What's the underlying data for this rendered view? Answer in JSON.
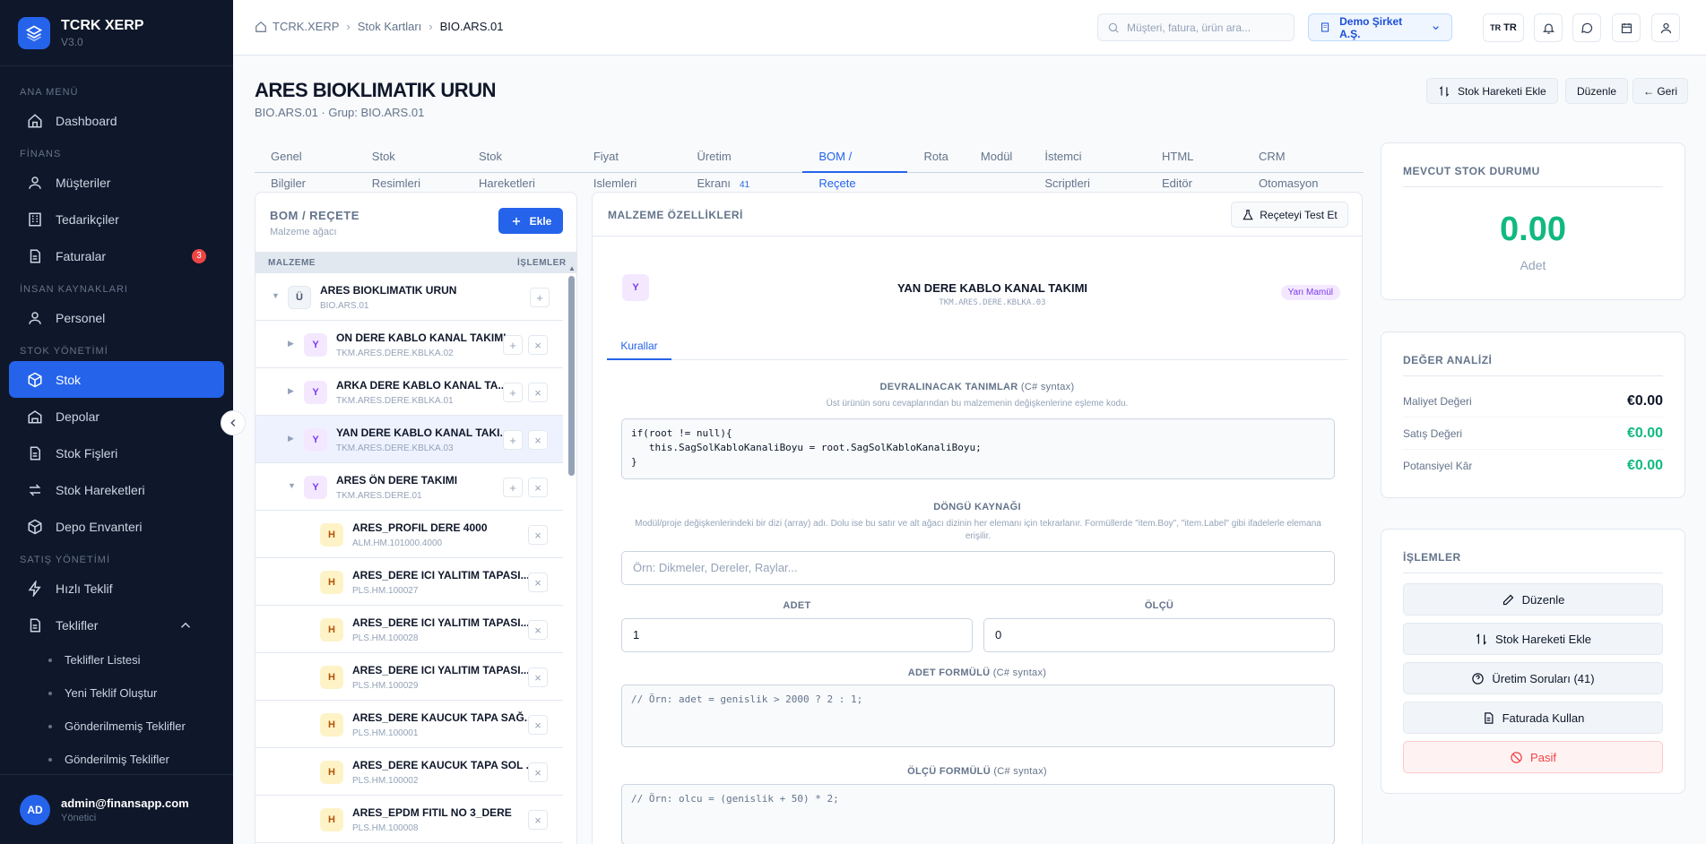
{
  "app": {
    "name": "TCRK XERP",
    "version": "V3.0"
  },
  "sidebar": {
    "sections": [
      "ANA MENÜ",
      "FİNANS",
      "İNSAN KAYNAKLARI",
      "STOK YÖNETİMİ",
      "SATIŞ YÖNETİMİ"
    ],
    "items": {
      "dashboard": "Dashboard",
      "musteriler": "Müşteriler",
      "tedarikciler": "Tedarikçiler",
      "faturalar": "Faturalar",
      "faturalar_badge": "3",
      "personel": "Personel",
      "stok": "Stok",
      "depolar": "Depolar",
      "stok_fisleri": "Stok Fişleri",
      "stok_hareketleri": "Stok Hareketleri",
      "depo_envanteri": "Depo Envanteri",
      "hizli_teklif": "Hızlı Teklif",
      "teklifler": "Teklifler"
    },
    "subitems": [
      "Teklifler Listesi",
      "Yeni Teklif Oluştur",
      "Gönderilmemiş Teklifler",
      "Gönderilmiş Teklifler"
    ]
  },
  "user": {
    "initials": "AD",
    "email": "admin@finansapp.com",
    "role": "Yönetici"
  },
  "topbar": {
    "breadcrumb": [
      "TCRK.XERP",
      "Stok Kartları",
      "BIO.ARS.01"
    ],
    "search_placeholder": "Müşteri, fatura, ürün ara...",
    "company": "Demo Şirket A.Ş.",
    "lang": "TR"
  },
  "page": {
    "title": "ARES BIOKLIMATIK URUN",
    "subtitle": "BIO.ARS.01 · Grup: BIO.ARS.01",
    "actions": {
      "add_movement": "Stok Hareketi Ekle",
      "edit": "Düzenle",
      "back": "← Geri"
    }
  },
  "tabs": [
    "Genel Bilgiler",
    "Stok Resimleri",
    "Stok Hareketleri",
    "Fiyat Islemleri",
    "Üretim Ekranı",
    "BOM / Reçete",
    "Rota",
    "Modül",
    "İstemci Scriptleri",
    "HTML Editör",
    "CRM Otomasyon"
  ],
  "tab_count": "41",
  "bom": {
    "title": "BOM / REÇETE",
    "subtitle": "Malzeme ağacı",
    "add": "Ekle",
    "col_material": "MALZEME",
    "col_actions": "İŞLEMLER",
    "rows": [
      {
        "type": "Ü",
        "name": "ARES BIOKLIMATIK URUN",
        "code": "BIO.ARS.01"
      },
      {
        "type": "Y",
        "name": "ON DERE KABLO KANAL TAKIMI",
        "code": "TKM.ARES.DERE.KBLKA.02"
      },
      {
        "type": "Y",
        "name": "ARKA DERE KABLO KANAL TA...",
        "code": "TKM.ARES.DERE.KBLKA.01"
      },
      {
        "type": "Y",
        "name": "YAN DERE KABLO KANAL TAKI...",
        "code": "TKM.ARES.DERE.KBLKA.03"
      },
      {
        "type": "Y",
        "name": "ARES ÖN DERE TAKIMI",
        "code": "TKM.ARES.DERE.01"
      },
      {
        "type": "H",
        "name": "ARES_PROFIL DERE 4000",
        "code": "ALM.HM.101000.4000"
      },
      {
        "type": "H",
        "name": "ARES_DERE ICI YALITIM TAPASI...",
        "code": "PLS.HM.100027"
      },
      {
        "type": "H",
        "name": "ARES_DERE ICI YALITIM TAPASI...",
        "code": "PLS.HM.100028"
      },
      {
        "type": "H",
        "name": "ARES_DERE ICI YALITIM TAPASI...",
        "code": "PLS.HM.100029"
      },
      {
        "type": "H",
        "name": "ARES_DERE KAUCUK TAPA SAĞ...",
        "code": "PLS.HM.100001"
      },
      {
        "type": "H",
        "name": "ARES_DERE KAUCUK TAPA SOL ...",
        "code": "PLS.HM.100002"
      },
      {
        "type": "H",
        "name": "ARES_EPDM FITIL NO 3_DERE",
        "code": "PLS.HM.100008"
      }
    ]
  },
  "material": {
    "title": "MALZEME ÖZELLİKLERİ",
    "test_button": "Reçeteyi Test Et",
    "selected_type": "Y",
    "selected_name": "YAN DERE KABLO KANAL TAKIMI",
    "selected_code": "TKM.ARES.DERE.KBLKA.03",
    "badge": "Yarı Mamül",
    "subtab": "Kurallar",
    "inherit_label": "DEVRALINACAK TANIMLAR",
    "syntax": "(C# syntax)",
    "inherit_desc": "Üst ürünün soru cevaplarından bu malzemenin değişkenlerine eşleme kodu.",
    "inherit_code": "if(root != null){\n   this.SagSolKabloKanaliBoyu = root.SagSolKabloKanaliBoyu;\n}",
    "loop_label": "DÖNGÜ KAYNAĞI",
    "loop_desc": "Modül/proje değişkenlerindeki bir dizi (array) adı. Dolu ise bu satır ve alt ağacı dizinin her elemanı için tekrarlanır. Formüllerde \"item.Boy\", \"item.Label\" gibi ifadelerle elemana erişilir.",
    "loop_placeholder": "Örn: Dikmeler, Dereler, Raylar...",
    "adet_label": "ADET",
    "adet_value": "1",
    "olcu_label": "ÖLÇÜ",
    "olcu_value": "0",
    "adet_formula_label": "ADET FORMÜLÜ",
    "adet_formula": "// Örn: adet = genislik > 2000 ? 2 : 1;",
    "olcu_formula_label": "ÖLÇÜ FORMÜLÜ",
    "olcu_formula": "// Örn: olcu = (genislik + 50) * 2;"
  },
  "stock": {
    "title": "MEVCUT STOK DURUMU",
    "value": "0.00",
    "unit": "Adet"
  },
  "value_analysis": {
    "title": "DEĞER ANALİZİ",
    "rows": [
      {
        "label": "Maliyet Değeri",
        "value": "€0.00"
      },
      {
        "label": "Satış Değeri",
        "value": "€0.00"
      },
      {
        "label": "Potansiyel Kâr",
        "value": "€0.00"
      }
    ]
  },
  "operations": {
    "title": "İŞLEMLER",
    "buttons": [
      "Düzenle",
      "Stok Hareketi Ekle",
      "Üretim Soruları (41)",
      "Faturada Kullan",
      "Pasif"
    ]
  },
  "colors": {
    "primary": "#2563eb",
    "success": "#10b981",
    "danger": "#ef4444",
    "sidebar": "#0f172a"
  }
}
